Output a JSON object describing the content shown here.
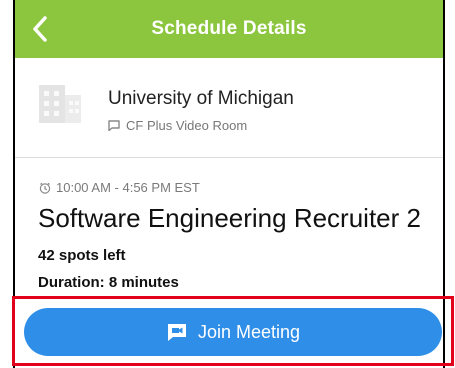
{
  "header": {
    "title": "Schedule Details"
  },
  "organization": {
    "name": "University of Michigan",
    "room": "CF Plus Video Room"
  },
  "event": {
    "time_range": "10:00 AM - 4:56 PM EST",
    "title": "Software Engineering Recruiter 2",
    "spots": "42 spots left",
    "duration": "Duration: 8 minutes"
  },
  "actions": {
    "join_label": "Join Meeting"
  },
  "colors": {
    "header_bg": "#8cc63f",
    "button_bg": "#2f8fe8",
    "highlight": "#e3001b"
  },
  "icons": {
    "back": "chevron-left-icon",
    "building": "building-icon",
    "room": "chat-icon",
    "time": "clock-icon",
    "join": "video-chat-icon"
  }
}
